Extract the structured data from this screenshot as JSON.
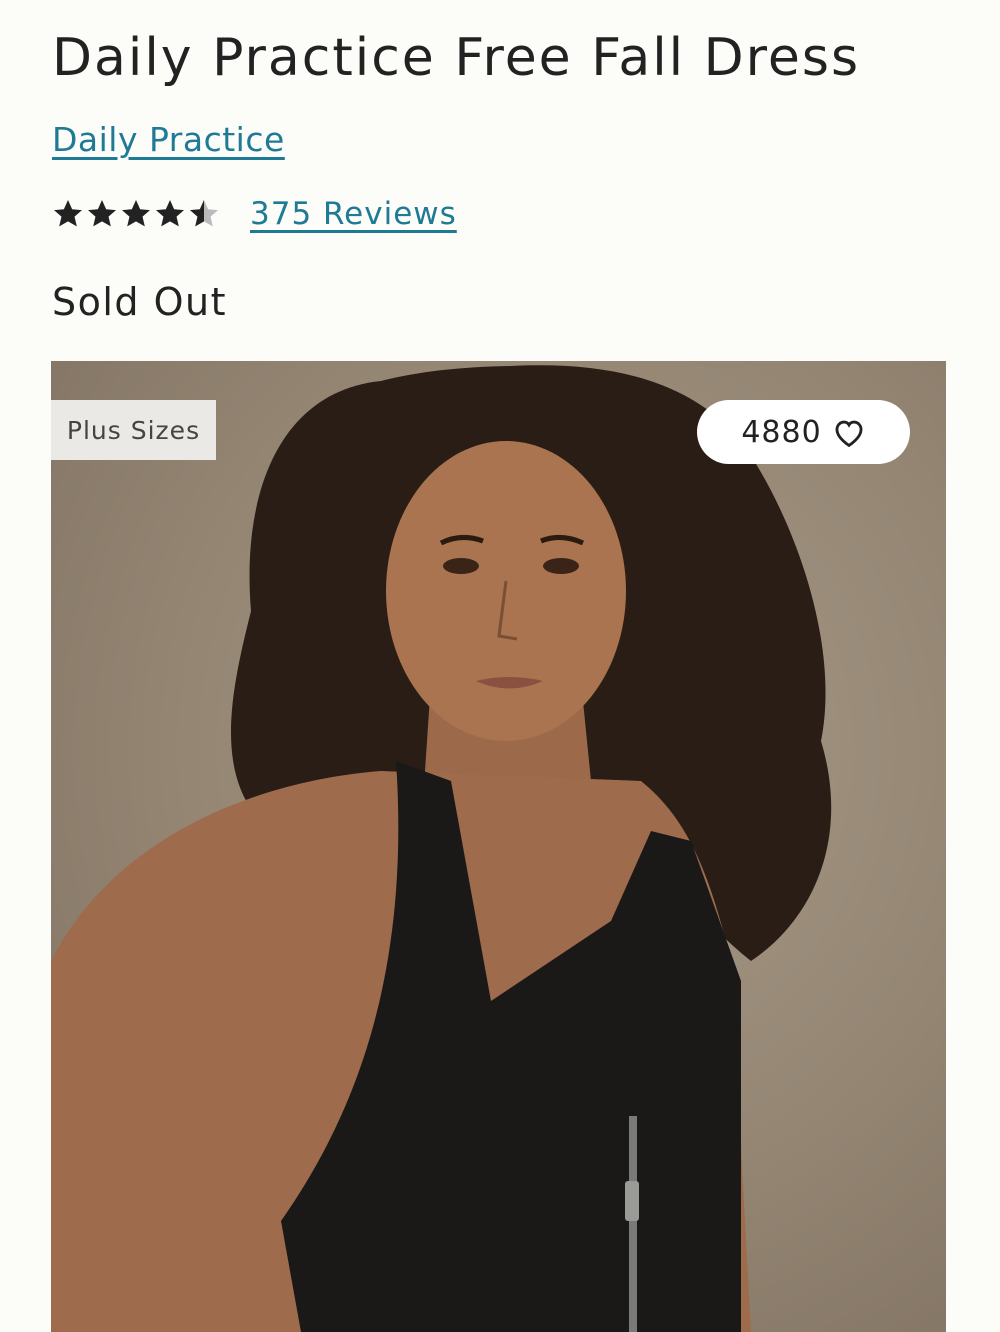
{
  "product": {
    "title": "Daily Practice Free Fall Dress",
    "brand": "Daily Practice",
    "rating": 4.5,
    "reviews_label": "375 Reviews",
    "status": "Sold Out"
  },
  "image": {
    "badge": "Plus Sizes",
    "favorite_count": "4880",
    "favorite_icon": "heart-outline-icon"
  },
  "colors": {
    "link": "#1f7a95",
    "text": "#222222",
    "background": "#fcfcf9"
  }
}
